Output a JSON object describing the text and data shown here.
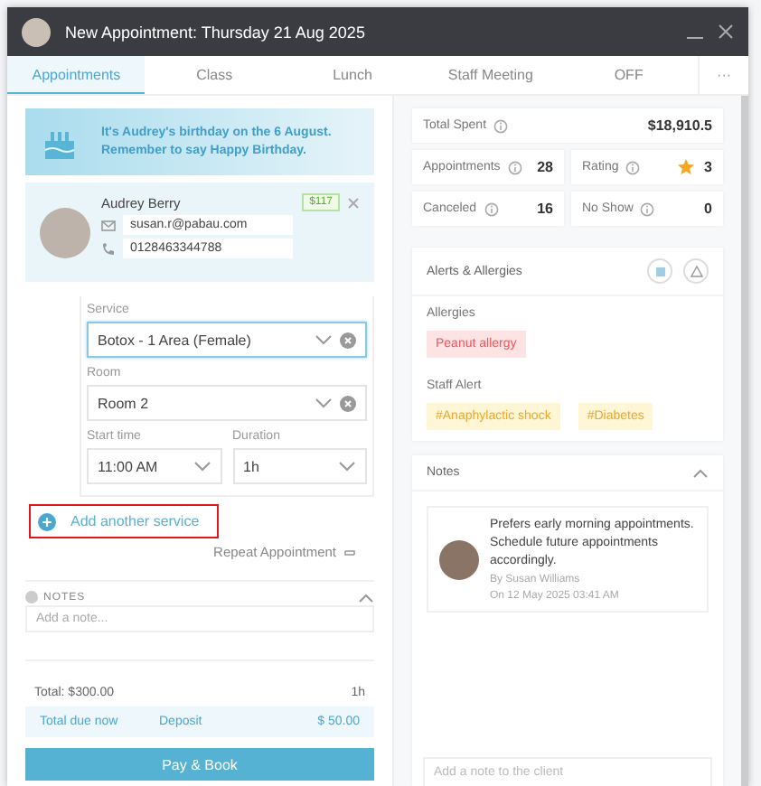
{
  "window": {
    "title": "New Appointment: Thursday 21 Aug 2025"
  },
  "tabs": [
    {
      "label": "Appointments",
      "selected": true
    },
    {
      "label": "Class",
      "selected": false
    },
    {
      "label": "Lunch",
      "selected": false
    },
    {
      "label": "Staff Meeting",
      "selected": false
    },
    {
      "label": "OFF",
      "selected": false
    }
  ],
  "more_button": "···",
  "birthday_banner": {
    "lines": [
      "It's Audrey's birthday on the 6 August.",
      "Remember to say Happy Birthday."
    ]
  },
  "client": {
    "name": "Audrey Berry",
    "badge": "$117",
    "email": "susan.r@pabau.com",
    "phone": "0128463344788"
  },
  "service_form": {
    "fields": [
      {
        "label": "Service",
        "value": "Botox - 1 Area (Female)",
        "clearable": true,
        "focused": true
      },
      {
        "label": "Room",
        "value": "Room 2",
        "clearable": true,
        "focused": false
      },
      {
        "label": "Start time",
        "value": "11:00 AM",
        "clearable": false,
        "focused": false
      },
      {
        "label": "Duration",
        "value": "1h",
        "clearable": false,
        "focused": false
      }
    ]
  },
  "add_service": {
    "label": "Add another service",
    "highlighted": true
  },
  "repeat_link": "Repeat Appointment",
  "notes": {
    "heading": "NOTES",
    "placeholder": "Add a note...",
    "expanded": true
  },
  "totals": {
    "total": "Total: $300.00",
    "duration": "1h",
    "due_label": "Total due now",
    "deposit_label": "Deposit",
    "deposit": "$ 50.00"
  },
  "pay_button": "Pay & Book",
  "stats": {
    "total_spent": {
      "label": "Total Spent",
      "value": "$18,910.5"
    },
    "cards": [
      {
        "label": "Appointments",
        "value": "28",
        "kind": "count"
      },
      {
        "label": "Rating",
        "value": "3",
        "kind": "rating"
      },
      {
        "label": "Canceled",
        "value": "16",
        "kind": "count"
      },
      {
        "label": "No Show",
        "value": "0",
        "kind": "count"
      }
    ]
  },
  "alerts": {
    "title": "Alerts & Allergies",
    "allergies_label": "Allergies",
    "allergies": [
      "Peanut allergy"
    ],
    "staff_alert_label": "Staff Alert",
    "staff_alerts": [
      "#Anaphylactic shock",
      "#Diabetes"
    ]
  },
  "client_notes": {
    "title": "Notes",
    "expanded": true,
    "items": [
      {
        "text": "Prefers early morning appointments. Schedule future appointments accordingly.",
        "author": "By Susan Williams",
        "date": "On 12 May 2025 03:41 AM"
      }
    ],
    "placeholder": "Add a note to the client"
  }
}
